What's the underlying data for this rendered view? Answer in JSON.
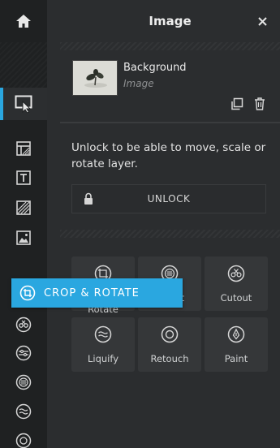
{
  "header": {
    "title": "Image"
  },
  "layer": {
    "name": "Background",
    "type": "Image"
  },
  "message": "Unlock to be able to move, scale or rotate layer.",
  "unlock_button": {
    "label": "UNLOCK"
  },
  "tools": [
    {
      "label": "Crop & Rotate",
      "icon": "crop-rotate-icon"
    },
    {
      "label": "Adjust",
      "icon": "adjust-icon"
    },
    {
      "label": "Cutout",
      "icon": "cutout-icon"
    },
    {
      "label": "Liquify",
      "icon": "liquify-icon"
    },
    {
      "label": "Retouch",
      "icon": "retouch-icon"
    },
    {
      "label": "Paint",
      "icon": "paint-icon"
    }
  ],
  "tooltip": {
    "label": "CROP & ROTATE",
    "icon": "crop-rotate-icon"
  },
  "colors": {
    "accent": "#2aa7e0",
    "panel": "#2b2d2f",
    "rail": "#1f2122",
    "tile": "#353739"
  }
}
